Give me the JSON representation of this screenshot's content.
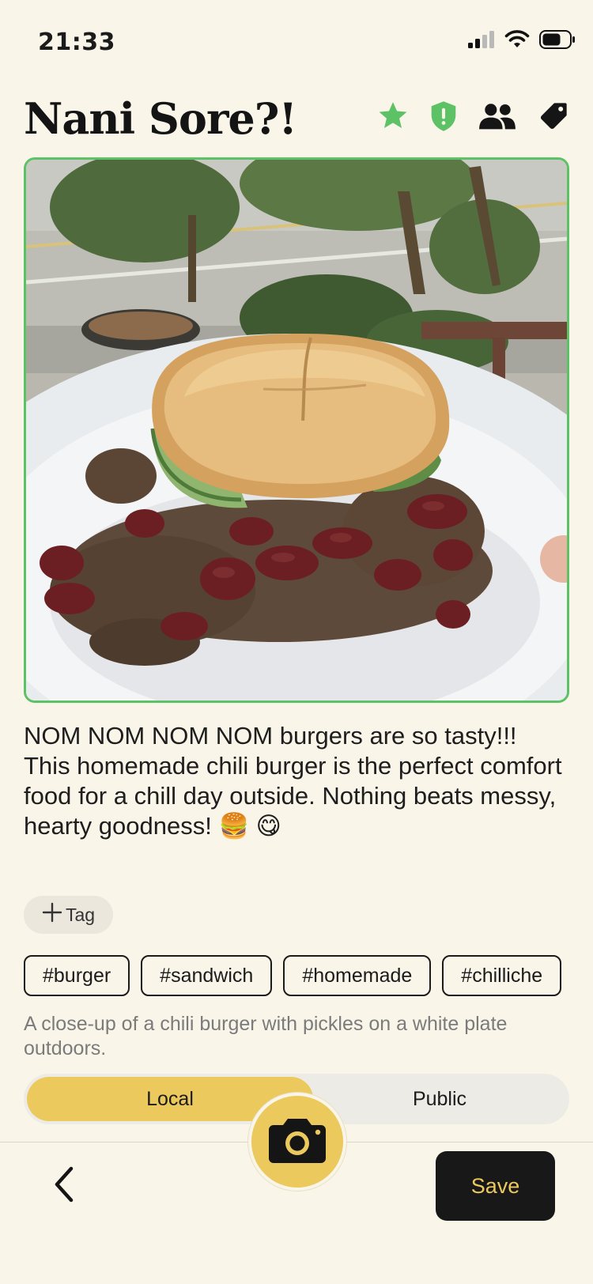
{
  "status_bar": {
    "time": "21:33"
  },
  "header": {
    "title": "Nani Sore?!",
    "icons": [
      "star-icon",
      "shield-alert-icon",
      "people-icon",
      "tag-icon"
    ]
  },
  "photo": {
    "subject": "chili burger with pickles on a white plate outdoors"
  },
  "caption": "NOM NOM NOM NOM burgers are so tasty!!! This homemade chili burger is the perfect comfort food for a chill day outside. Nothing beats messy, hearty goodness! 🍔 😋",
  "add_tag": {
    "label": "Tag"
  },
  "tags": [
    "#burger",
    "#sandwich",
    "#homemade",
    "#chilliche"
  ],
  "alt_text": "A close-up of a chili burger with pickles on a white plate outdoors.",
  "visibility": {
    "local": "Local",
    "public": "Public",
    "selected": "Local"
  },
  "bottom_bar": {
    "save_label": "Save"
  },
  "colors": {
    "background": "#faf5e9",
    "accent_yellow": "#ecc95c",
    "accent_green": "#5cc265",
    "dark": "#181818"
  }
}
